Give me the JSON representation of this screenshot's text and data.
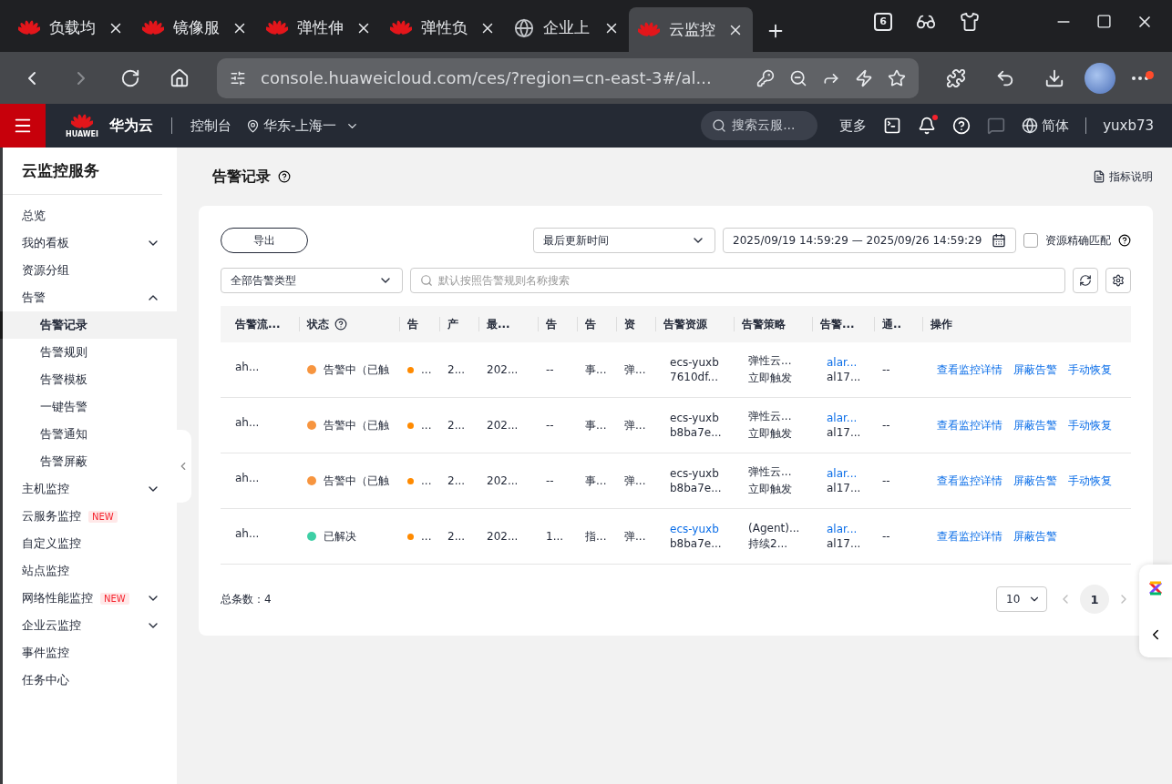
{
  "browser": {
    "tabs": [
      {
        "title": "负载均",
        "selected": false
      },
      {
        "title": "镜像服",
        "selected": false
      },
      {
        "title": "弹性伸",
        "selected": false
      },
      {
        "title": "弹性负",
        "selected": false
      },
      {
        "title": "企业上",
        "selected": false
      },
      {
        "title": "云监控",
        "selected": true
      }
    ],
    "tab_count": "6",
    "url": "console.huaweicloud.com/ces/?region=cn-east-3#/al...",
    "menu_alert": true
  },
  "topbar": {
    "logo_text": "HUAWEI",
    "brand": "华为云",
    "console": "控制台",
    "region": "华东-上海一",
    "search_placeholder": "搜索云服...",
    "more": "更多",
    "notification_dot": true,
    "language": "简体",
    "user": "yuxb73"
  },
  "sidebar": {
    "title": "云监控服务",
    "items": [
      {
        "label": "总览",
        "selected": false
      },
      {
        "label": "我的看板",
        "expanded": false,
        "selected": false
      },
      {
        "label": "资源分组",
        "selected": false
      },
      {
        "label": "告警",
        "expanded": true,
        "selected": false,
        "children": [
          {
            "label": "告警记录",
            "selected": true
          },
          {
            "label": "告警规则",
            "selected": false
          },
          {
            "label": "告警模板",
            "selected": false
          },
          {
            "label": "一键告警",
            "selected": false
          },
          {
            "label": "告警通知",
            "selected": false
          },
          {
            "label": "告警屏蔽",
            "selected": false
          }
        ]
      },
      {
        "label": "主机监控",
        "expanded": false,
        "selected": false
      },
      {
        "label": "云服务监控",
        "badge": "NEW",
        "selected": false
      },
      {
        "label": "自定义监控",
        "selected": false
      },
      {
        "label": "站点监控",
        "selected": false
      },
      {
        "label": "网络性能监控",
        "badge": "NEW",
        "expanded": false,
        "selected": false
      },
      {
        "label": "企业云监控",
        "expanded": false,
        "selected": false
      },
      {
        "label": "事件监控",
        "selected": false
      },
      {
        "label": "任务中心",
        "selected": false
      }
    ]
  },
  "page": {
    "title": "告警记录",
    "doc_link": "指标说明"
  },
  "toolbar": {
    "export": "导出",
    "time_field": "最后更新时间",
    "date_range": "2025/09/19 14:59:29 — 2025/09/26 14:59:29",
    "exact_match": {
      "label": "资源精确匹配",
      "checked": false
    },
    "alarm_type": "全部告警类型",
    "search_placeholder": "默认按照告警规则名称搜索"
  },
  "table": {
    "columns": [
      {
        "label": "告警流..."
      },
      {
        "label": "状态"
      },
      {
        "label": "告"
      },
      {
        "label": "产"
      },
      {
        "label": "最..."
      },
      {
        "label": "告"
      },
      {
        "label": "告"
      },
      {
        "label": "资"
      },
      {
        "label": "告警资源"
      },
      {
        "label": "告警策略"
      },
      {
        "label": "告警..."
      },
      {
        "label": "通.."
      },
      {
        "label": "操作"
      }
    ],
    "rows": [
      {
        "cells": [
          {
            "kind": "text",
            "text": "ah..."
          },
          {
            "kind": "status",
            "text": "告警中（已触",
            "color": "#f7953f"
          },
          {
            "kind": "level",
            "text": "...",
            "color": "#ff8a00"
          },
          {
            "kind": "text",
            "text": "2..."
          },
          {
            "kind": "text",
            "text": "202..."
          },
          {
            "kind": "text",
            "text": "--"
          },
          {
            "kind": "text",
            "text": "事..."
          },
          {
            "kind": "text",
            "text": "弹..."
          },
          {
            "kind": "lines",
            "lines": [
              {
                "text": "ecs-yuxb",
                "link": false
              },
              {
                "text": "7610df...",
                "link": false
              }
            ]
          },
          {
            "kind": "lines",
            "lines": [
              {
                "text": "弹性云...",
                "link": false
              },
              {
                "text": "立即触发",
                "link": false
              }
            ]
          },
          {
            "kind": "lines",
            "lines": [
              {
                "text": "alar...",
                "link": true
              },
              {
                "text": "al17...",
                "link": false
              }
            ]
          },
          {
            "kind": "text",
            "text": "--"
          },
          {
            "kind": "actions",
            "actions": [
              "查看监控详情",
              "屏蔽告警",
              "手动恢复"
            ]
          }
        ]
      },
      {
        "cells": [
          {
            "kind": "text",
            "text": "ah..."
          },
          {
            "kind": "status",
            "text": "告警中（已触",
            "color": "#f7953f"
          },
          {
            "kind": "level",
            "text": "...",
            "color": "#ff8a00"
          },
          {
            "kind": "text",
            "text": "2..."
          },
          {
            "kind": "text",
            "text": "202..."
          },
          {
            "kind": "text",
            "text": "--"
          },
          {
            "kind": "text",
            "text": "事..."
          },
          {
            "kind": "text",
            "text": "弹..."
          },
          {
            "kind": "lines",
            "lines": [
              {
                "text": "ecs-yuxb",
                "link": false
              },
              {
                "text": "b8ba7e...",
                "link": false
              }
            ]
          },
          {
            "kind": "lines",
            "lines": [
              {
                "text": "弹性云...",
                "link": false
              },
              {
                "text": "立即触发",
                "link": false
              }
            ]
          },
          {
            "kind": "lines",
            "lines": [
              {
                "text": "alar...",
                "link": true
              },
              {
                "text": "al17...",
                "link": false
              }
            ]
          },
          {
            "kind": "text",
            "text": "--"
          },
          {
            "kind": "actions",
            "actions": [
              "查看监控详情",
              "屏蔽告警",
              "手动恢复"
            ]
          }
        ]
      },
      {
        "cells": [
          {
            "kind": "text",
            "text": "ah..."
          },
          {
            "kind": "status",
            "text": "告警中（已触",
            "color": "#f7953f"
          },
          {
            "kind": "level",
            "text": "...",
            "color": "#ff8a00"
          },
          {
            "kind": "text",
            "text": "2..."
          },
          {
            "kind": "text",
            "text": "202..."
          },
          {
            "kind": "text",
            "text": "--"
          },
          {
            "kind": "text",
            "text": "事..."
          },
          {
            "kind": "text",
            "text": "弹..."
          },
          {
            "kind": "lines",
            "lines": [
              {
                "text": "ecs-yuxb",
                "link": false
              },
              {
                "text": "b8ba7e...",
                "link": false
              }
            ]
          },
          {
            "kind": "lines",
            "lines": [
              {
                "text": "弹性云...",
                "link": false
              },
              {
                "text": "立即触发",
                "link": false
              }
            ]
          },
          {
            "kind": "lines",
            "lines": [
              {
                "text": "alar...",
                "link": true
              },
              {
                "text": "al17...",
                "link": false
              }
            ]
          },
          {
            "kind": "text",
            "text": "--"
          },
          {
            "kind": "actions",
            "actions": [
              "查看监控详情",
              "屏蔽告警",
              "手动恢复"
            ]
          }
        ]
      },
      {
        "cells": [
          {
            "kind": "text",
            "text": "ah..."
          },
          {
            "kind": "status",
            "text": "已解决",
            "color": "#3ecfa5"
          },
          {
            "kind": "level",
            "text": "...",
            "color": "#ff8a00"
          },
          {
            "kind": "text",
            "text": "2..."
          },
          {
            "kind": "text",
            "text": "202..."
          },
          {
            "kind": "text",
            "text": "1..."
          },
          {
            "kind": "text",
            "text": "指..."
          },
          {
            "kind": "text",
            "text": "弹..."
          },
          {
            "kind": "lines",
            "lines": [
              {
                "text": "ecs-yuxb",
                "link": true
              },
              {
                "text": "b8ba7e...",
                "link": false
              }
            ]
          },
          {
            "kind": "lines",
            "lines": [
              {
                "text": "(Agent)...",
                "link": false
              },
              {
                "text": "持续2...",
                "link": false
              }
            ]
          },
          {
            "kind": "lines",
            "lines": [
              {
                "text": "alar...",
                "link": true
              },
              {
                "text": "al17...",
                "link": false
              }
            ]
          },
          {
            "kind": "text",
            "text": "--"
          },
          {
            "kind": "actions",
            "actions": [
              "查看监控详情",
              "屏蔽告警"
            ]
          }
        ]
      }
    ]
  },
  "footer": {
    "total": "总条数：4",
    "page_size": "10",
    "pages": [
      {
        "label": "1",
        "selected": true
      }
    ]
  }
}
